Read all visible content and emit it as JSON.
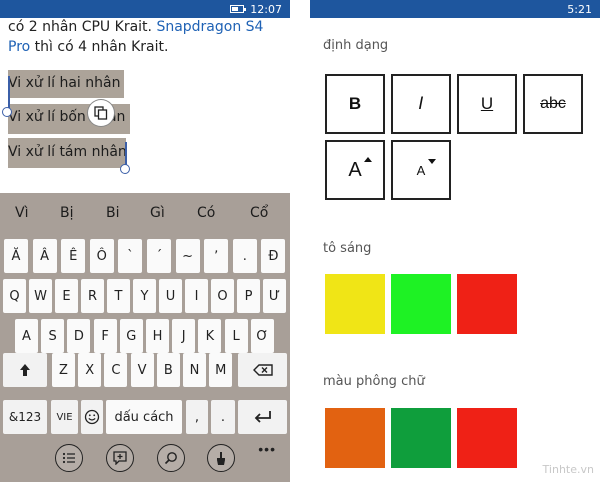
{
  "left": {
    "status": {
      "time": "12:07"
    },
    "document": {
      "line1_prefix": "có 2 nhân CPU Krait. ",
      "line1_link": "Snapdragon S4",
      "line2_link": "Pro",
      "line2_rest": " thì có 4 nhân Krait.",
      "selected_lines": [
        "Vi xử lí hai nhân",
        "Vi xử lí bốn nhân",
        "Vi xử lí tám nhân"
      ]
    },
    "suggestions": [
      "Vì",
      "Bị",
      "Bi",
      "Gì",
      "Có",
      "Cổ"
    ],
    "keyboard": {
      "row1": [
        "Ă",
        "Â",
        "Ê",
        "Ô",
        "`",
        "´",
        "~",
        "ʼ",
        ".",
        "Đ"
      ],
      "row2": [
        "Q",
        "W",
        "E",
        "R",
        "T",
        "Y",
        "U",
        "I",
        "O",
        "P",
        "Ư"
      ],
      "row3": [
        "A",
        "S",
        "D",
        "F",
        "G",
        "H",
        "J",
        "K",
        "L",
        "Ơ"
      ],
      "row4": [
        "Z",
        "X",
        "C",
        "V",
        "B",
        "N",
        "M"
      ],
      "shift_icon": "shift-arrow-icon",
      "backspace_icon": "backspace-icon",
      "num_label": "&123",
      "lang_label": "VIE",
      "emoji_icon": "emoji-icon",
      "space_label": "dấu cách",
      "comma_label": ",",
      "period_label": ".",
      "enter_icon": "enter-icon"
    },
    "appbar": {
      "icons": [
        "list-format-icon",
        "comment-icon",
        "find-icon",
        "format-brush-icon"
      ],
      "more": "•••"
    }
  },
  "right": {
    "status": {
      "time": "5:21"
    },
    "format_label": "định dạng",
    "format_buttons": [
      "B",
      "I",
      "U",
      "abc"
    ],
    "size_buttons": [
      "A",
      "A"
    ],
    "highlight_label": "tô sáng",
    "highlight_colors": [
      "#f0e516",
      "#1ef224",
      "#ef2116"
    ],
    "font_color_label": "màu phông chữ",
    "font_colors": [
      "#e26211",
      "#0f9e3c",
      "#ef2116"
    ],
    "watermark": "Tinhte.vn"
  }
}
